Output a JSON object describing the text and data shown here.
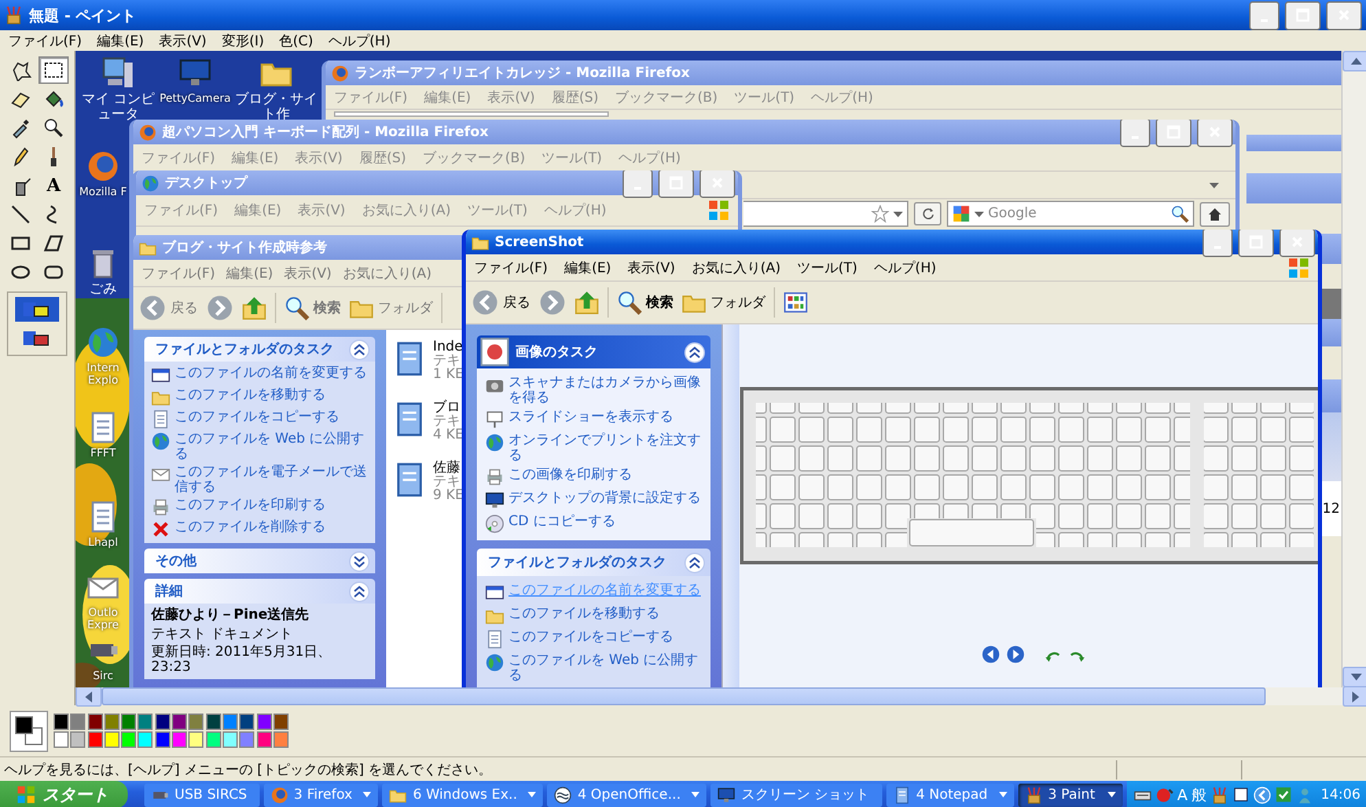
{
  "window": {
    "title": "無題 - ペイント"
  },
  "menu": [
    "ファイル(F)",
    "編集(E)",
    "表示(V)",
    "変形(I)",
    "色(C)",
    "ヘルプ(H)"
  ],
  "tools": [
    {
      "kind": "free-select",
      "selected": false
    },
    {
      "kind": "rect-select",
      "selected": true
    },
    {
      "kind": "eraser",
      "selected": false
    },
    {
      "kind": "fill",
      "selected": false
    },
    {
      "kind": "picker",
      "selected": false
    },
    {
      "kind": "magnifier",
      "selected": false
    },
    {
      "kind": "pencil",
      "selected": false
    },
    {
      "kind": "brush",
      "selected": false
    },
    {
      "kind": "airbrush",
      "selected": false
    },
    {
      "kind": "text",
      "label": "A",
      "selected": false
    },
    {
      "kind": "line",
      "selected": false
    },
    {
      "kind": "curve",
      "selected": false
    },
    {
      "kind": "rectangle",
      "selected": false
    },
    {
      "kind": "polygon",
      "selected": false
    },
    {
      "kind": "ellipse",
      "selected": false
    },
    {
      "kind": "rounded-rectangle",
      "selected": false
    }
  ],
  "tool_options": [
    {
      "selected": true
    },
    {
      "selected": false
    }
  ],
  "canvas": {
    "desktop_icons": [
      {
        "label": "マイ コンピュータ",
        "kind": "computer"
      },
      {
        "label": "PettyCamera",
        "kind": "monitor"
      },
      {
        "label": "ブログ・サイト作",
        "kind": "folder"
      },
      {
        "label": "Mozilla F",
        "kind": "browser"
      },
      {
        "label": "ごみ",
        "kind": "trash"
      },
      {
        "label": "Intern Explo",
        "kind": "globe"
      },
      {
        "label": "FFFT",
        "kind": "doc"
      },
      {
        "label": "Lhapl",
        "kind": "doc"
      },
      {
        "label": "Outlo Expre",
        "kind": "envelope"
      },
      {
        "label": "Sirc",
        "kind": "usb"
      }
    ],
    "browser_back": {
      "title": "ランボーアフィリエイトカレッジ - Mozilla Firefox",
      "active": false,
      "menu": [
        "ファイル(F)",
        "編集(E)",
        "表示(V)",
        "履歴(S)",
        "ブックマーク(B)",
        "ツール(T)",
        "ヘルプ(H)"
      ],
      "side_text": "12"
    },
    "browser_front": {
      "title": "超パソコン入門 キーボード配列 - Mozilla Firefox",
      "active": false,
      "menu": [
        "ファイル(F)",
        "編集(E)",
        "表示(V)",
        "履歴(S)",
        "ブックマーク(B)",
        "ツール(T)",
        "ヘルプ(H)"
      ],
      "search": {
        "placeholder": "Google"
      }
    },
    "desktop_window": {
      "title": "デスクトップ",
      "active": false,
      "menu": [
        "ファイル(F)",
        "編集(E)",
        "表示(V)",
        "お気に入り(A)",
        "ツール(T)",
        "ヘルプ(H)"
      ]
    },
    "folder_window": {
      "title": "ブログ・サイト作成時参考",
      "active": false,
      "menu": [
        "ファイル(F)",
        "編集(E)",
        "表示(V)",
        "お気に入り(A)"
      ],
      "toolbar": [
        "戻る",
        "検索",
        "フォルダ"
      ],
      "panels": [
        {
          "title": "ファイルとフォルダのタスク",
          "highlighted": false,
          "expanded": true,
          "items": [
            {
              "label": "このファイルの名前を変更する",
              "kind": "rename"
            },
            {
              "label": "このファイルを移動する",
              "kind": "move"
            },
            {
              "label": "このファイルをコピーする",
              "kind": "copy"
            },
            {
              "label": "このファイルを Web に公開する",
              "kind": "web"
            },
            {
              "label": "このファイルを電子メールで送信する",
              "kind": "mail"
            },
            {
              "label": "このファイルを印刷する",
              "kind": "print"
            },
            {
              "label": "このファイルを削除する",
              "kind": "delete"
            }
          ]
        },
        {
          "title": "その他",
          "highlighted": false,
          "expanded": false
        },
        {
          "title": "詳細",
          "highlighted": false,
          "expanded": true,
          "details": {
            "name": "佐藤ひより－Pine送信先",
            "type": "テキスト ドキュメント",
            "modified": "更新日時: 2011年5月31日、23:23"
          }
        }
      ],
      "files": [
        {
          "name": "Inde",
          "type": "テキ",
          "size": "1 KE"
        },
        {
          "name": "ブロ",
          "type": "テキ",
          "size": "4 KE"
        },
        {
          "name": "佐藤",
          "type": "テキ",
          "size": "9 KE"
        }
      ]
    },
    "screenshot_window": {
      "title": "ScreenShot",
      "active": true,
      "menu": [
        "ファイル(F)",
        "編集(E)",
        "表示(V)",
        "お気に入り(A)",
        "ツール(T)",
        "ヘルプ(H)"
      ],
      "toolbar": [
        "戻る",
        "検索",
        "フォルダ"
      ],
      "panels": [
        {
          "title": "画像のタスク",
          "highlighted": true,
          "expanded": true,
          "items": [
            {
              "label": "スキャナまたはカメラから画像を得る",
              "kind": "scan",
              "hovered": false
            },
            {
              "label": "スライドショーを表示する",
              "kind": "slideshow",
              "hovered": false
            },
            {
              "label": "オンラインでプリントを注文する",
              "kind": "order",
              "hovered": false
            },
            {
              "label": "この画像を印刷する",
              "kind": "print",
              "hovered": false
            },
            {
              "label": "デスクトップの背景に設定する",
              "kind": "background",
              "hovered": false
            },
            {
              "label": "CD にコピーする",
              "kind": "cd",
              "hovered": false
            }
          ]
        },
        {
          "title": "ファイルとフォルダのタスク",
          "highlighted": false,
          "expanded": true,
          "items": [
            {
              "label": "このファイルの名前を変更する",
              "kind": "rename",
              "hovered": true
            },
            {
              "label": "このファイルを移動する",
              "kind": "move",
              "hovered": false
            },
            {
              "label": "このファイルをコピーする",
              "kind": "copy",
              "hovered": false
            },
            {
              "label": "このファイルを Web に公開する",
              "kind": "web",
              "hovered": false
            }
          ]
        }
      ],
      "preview": {
        "kind": "picture"
      }
    }
  },
  "palette": {
    "primary": {
      "color": "#000000"
    },
    "secondary": {
      "color": "#ffffff"
    },
    "colors": [
      {
        "color": "#000000"
      },
      {
        "color": "#808080"
      },
      {
        "color": "#800000"
      },
      {
        "color": "#808000"
      },
      {
        "color": "#008000"
      },
      {
        "color": "#008080"
      },
      {
        "color": "#000080"
      },
      {
        "color": "#800080"
      },
      {
        "color": "#808040"
      },
      {
        "color": "#004040"
      },
      {
        "color": "#0080ff"
      },
      {
        "color": "#004080"
      },
      {
        "color": "#8000ff"
      },
      {
        "color": "#804000"
      },
      {
        "color": "#ffffff"
      },
      {
        "color": "#c0c0c0"
      },
      {
        "color": "#ff0000"
      },
      {
        "color": "#ffff00"
      },
      {
        "color": "#00ff00"
      },
      {
        "color": "#00ffff"
      },
      {
        "color": "#0000ff"
      },
      {
        "color": "#ff00ff"
      },
      {
        "color": "#ffff80"
      },
      {
        "color": "#00ff80"
      },
      {
        "color": "#80ffff"
      },
      {
        "color": "#8080ff"
      },
      {
        "color": "#ff0080"
      },
      {
        "color": "#ff8040"
      }
    ]
  },
  "status_bar": "ヘルプを見るには、[ヘルプ] メニューの [トピックの検索] を選んでください。",
  "taskbar": {
    "start": "スタート",
    "buttons": [
      {
        "label": "USB SIRCS",
        "kind": "usb",
        "group": false,
        "selected": false
      },
      {
        "label": "3 Firefox",
        "kind": "browser",
        "group": true,
        "selected": false
      },
      {
        "label": "6 Windows Ex..",
        "kind": "folder",
        "group": true,
        "selected": false
      },
      {
        "label": "4 OpenOffice...",
        "kind": "wave",
        "group": true,
        "selected": false
      },
      {
        "label": "スクリーン ショット",
        "kind": "monitor",
        "group": false,
        "selected": false
      },
      {
        "label": "4 Notepad",
        "kind": "notepad",
        "group": true,
        "selected": false
      },
      {
        "label": "3 Paint",
        "kind": "paint",
        "group": true,
        "selected": true
      }
    ],
    "ime": [
      "A",
      "般"
    ],
    "clock": "14:06"
  }
}
